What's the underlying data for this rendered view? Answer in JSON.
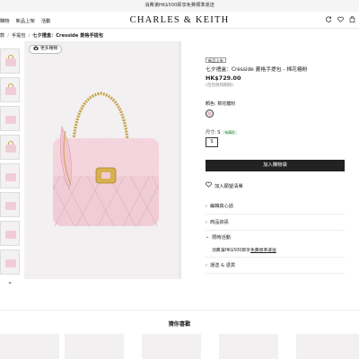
{
  "promo": {
    "text": "消費滿HK$500即享免費標準運送"
  },
  "header": {
    "nav": [
      "購物",
      "新品上架",
      "活動"
    ],
    "brand": "CHARLES & KEITH",
    "icons": [
      "refresh-icon",
      "heart-icon",
      "bag-icon"
    ]
  },
  "breadcrumb": {
    "items": [
      "款",
      "手提包"
    ],
    "current": "七夕禮盒：Cresside 菱格手提包"
  },
  "gallery": {
    "more_label": "更多種類",
    "thumbnail_count": 8
  },
  "product": {
    "badge": "新品上市",
    "title": "七夕禮盒：Cresside 菱格手提包 - 棉花糖粉",
    "price": "HK$729.00",
    "tax_note": "(包括稅和關稅)",
    "color_label": "顏色: 棉花糖粉",
    "swatch_color": "#e8bfc9",
    "size_label": "尺寸: S",
    "stock_badge": "有庫存",
    "size_value": "S",
    "add_to_cart": "加入購物袋",
    "wishlist": "加入願望清單"
  },
  "accordion": {
    "items": [
      {
        "label": "編輯真心話",
        "open": false
      },
      {
        "label": "商品資訊",
        "open": false
      },
      {
        "label": "限時活動",
        "open": true,
        "content_prefix": "消費滿HK$500即享",
        "content_link": "免費標準運送"
      },
      {
        "label": "運送 & 退貨",
        "open": false
      }
    ]
  },
  "recommendations": {
    "title": "猜你喜歡"
  },
  "colors": {
    "bag_pink": "#f0cdd6",
    "gold": "#c9a24a",
    "dark": "#222222"
  }
}
